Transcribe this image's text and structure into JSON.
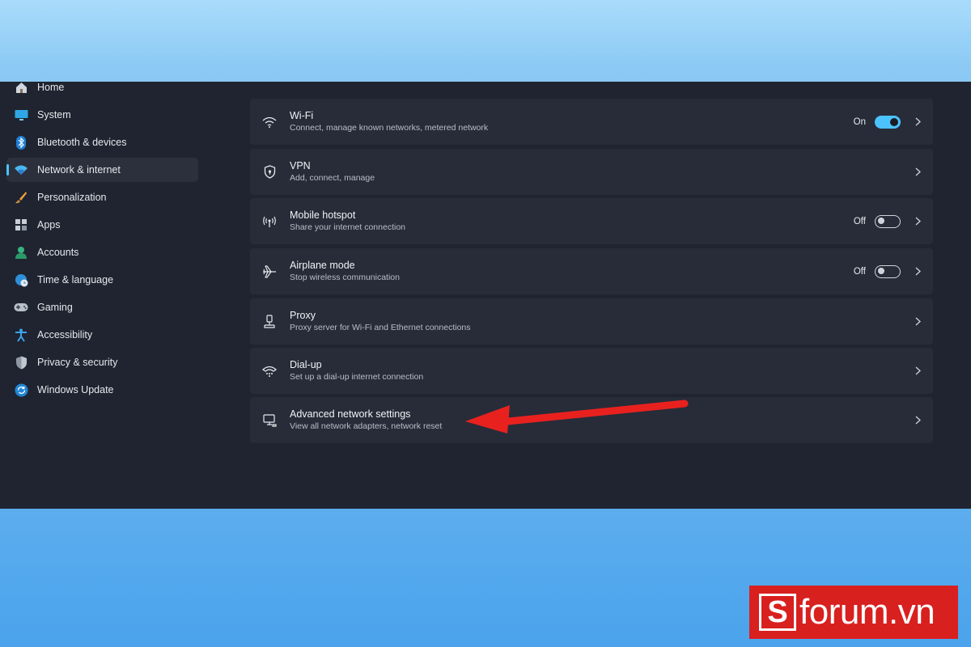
{
  "sidebar": {
    "items": [
      {
        "label": "Home",
        "icon": "home-icon"
      },
      {
        "label": "System",
        "icon": "monitor-icon"
      },
      {
        "label": "Bluetooth & devices",
        "icon": "bluetooth-icon"
      },
      {
        "label": "Network & internet",
        "icon": "wifi-icon",
        "active": true
      },
      {
        "label": "Personalization",
        "icon": "brush-icon"
      },
      {
        "label": "Apps",
        "icon": "apps-icon"
      },
      {
        "label": "Accounts",
        "icon": "person-icon"
      },
      {
        "label": "Time & language",
        "icon": "globe-clock-icon"
      },
      {
        "label": "Gaming",
        "icon": "gamepad-icon"
      },
      {
        "label": "Accessibility",
        "icon": "accessibility-icon"
      },
      {
        "label": "Privacy & security",
        "icon": "shield-icon"
      },
      {
        "label": "Windows Update",
        "icon": "sync-icon"
      }
    ]
  },
  "settings": [
    {
      "title": "Wi-Fi",
      "desc": "Connect, manage known networks, metered network",
      "state": "On",
      "toggle": true,
      "icon": "wifi-icon"
    },
    {
      "title": "VPN",
      "desc": "Add, connect, manage",
      "icon": "vpn-shield-icon"
    },
    {
      "title": "Mobile hotspot",
      "desc": "Share your internet connection",
      "state": "Off",
      "toggle": false,
      "icon": "hotspot-icon"
    },
    {
      "title": "Airplane mode",
      "desc": "Stop wireless communication",
      "state": "Off",
      "toggle": false,
      "icon": "airplane-icon"
    },
    {
      "title": "Proxy",
      "desc": "Proxy server for Wi-Fi and Ethernet connections",
      "icon": "proxy-icon"
    },
    {
      "title": "Dial-up",
      "desc": "Set up a dial-up internet connection",
      "icon": "dialup-icon"
    },
    {
      "title": "Advanced network settings",
      "desc": "View all network adapters, network reset",
      "icon": "network-adapter-icon"
    }
  ],
  "colors": {
    "accent": "#4cc2ff",
    "annotation_arrow": "#e8211f",
    "logo_bg": "#d8201f"
  },
  "logo": {
    "mark": "S",
    "text": "forum.vn"
  }
}
